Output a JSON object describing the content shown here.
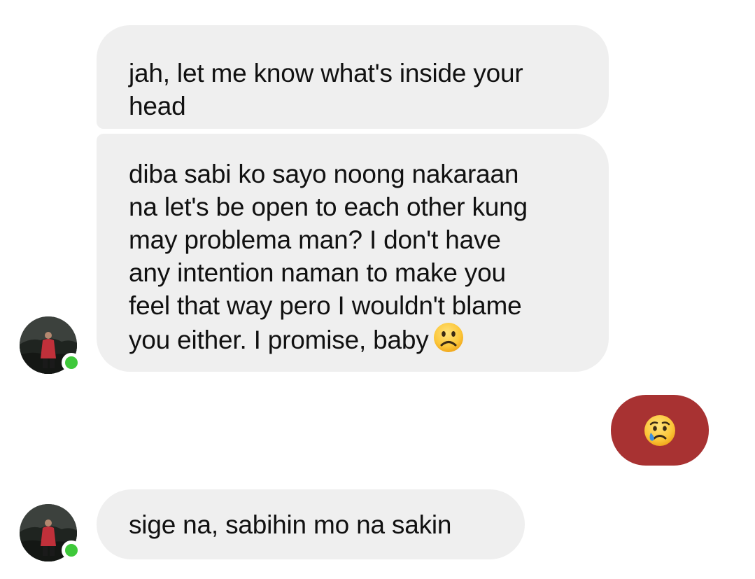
{
  "messages": [
    {
      "direction": "received",
      "lines": [
        "jah, let me know what's inside your",
        "head"
      ]
    },
    {
      "direction": "received",
      "lines": [
        "diba sabi ko sayo noong nakaraan",
        "na let's be open to each other kung",
        "may problema man? I don't have",
        "any intention naman to make you",
        "feel that way pero I wouldn't blame",
        "you either. I promise, baby"
      ],
      "trailing_emoji": "frowning-face-emoji"
    },
    {
      "direction": "sent",
      "emoji": "crying-face-emoji",
      "bubble_color": "#a83232"
    },
    {
      "direction": "received",
      "lines": [
        "sige na, sabihin mo na sakin"
      ]
    }
  ],
  "contact": {
    "avatar": "profile-photo",
    "online_status_color": "#3ec83a"
  },
  "colors": {
    "received_bubble": "#efefef",
    "sent_bubble": "#a83232",
    "text": "#111111"
  }
}
